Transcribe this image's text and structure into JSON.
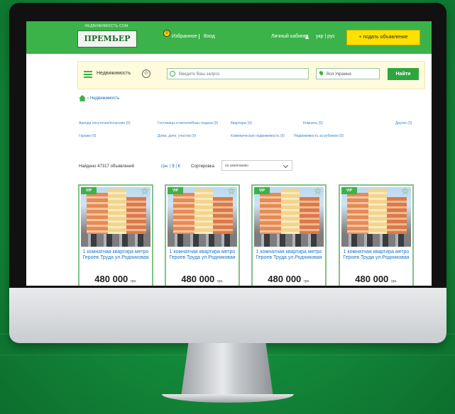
{
  "header": {
    "logo_tagline": "НЕДВИЖИМОСТЬ.COM",
    "logo": "ПРЕМЬЕР",
    "favorites_badge": "0",
    "favorites_label": "Избранное",
    "login_label": "Вход",
    "cabinet_label": "Личный кабинет",
    "lang_label": "укр | рус",
    "cta_label": "+  подать объявление"
  },
  "search": {
    "category_label": "Недвижимость",
    "category_circle": "⊙",
    "query_placeholder": "Введите Ваш запрос",
    "region_value": "Вся Украина",
    "submit_label": "Найти"
  },
  "breadcrumb": {
    "current": "Недвижимость"
  },
  "categories": [
    "Аренда посуточно/почасово (0)",
    "Гостиницы и мотели/базы отдыха (0)",
    "Квартиры (0)",
    "Комнаты (0)",
    "Другое (0)",
    "Гаражи (0)",
    "Дома, дачи, участки (0)",
    "Коммерческая недвижимость (0)",
    "Недвижимость за рубежом (0)"
  ],
  "results": {
    "count_text": "Найдено 47317 объявлений",
    "currency_text": "грн. | $ | €",
    "sort_label": "Сортировка",
    "sort_value": "по умолчанию"
  },
  "listings": [
    {
      "badge": "VIP",
      "title": "1 комнатная квартира метро Героев Труда ул.Родниковая",
      "price": "480 000",
      "currency": "грн."
    },
    {
      "badge": "VIP",
      "title": "1 комнатная квартира метро Героев Труда ул.Родниковая",
      "price": "480 000",
      "currency": "грн."
    },
    {
      "badge": "VIP",
      "title": "1 комнатная квартира метро Героев Труда ул.Родниковая",
      "price": "480 000",
      "currency": "грн."
    },
    {
      "badge": "VIP",
      "title": "1 комнатная квартира метро Героев Труда ул.Родниковая",
      "price": "480 000",
      "currency": "грн."
    }
  ]
}
